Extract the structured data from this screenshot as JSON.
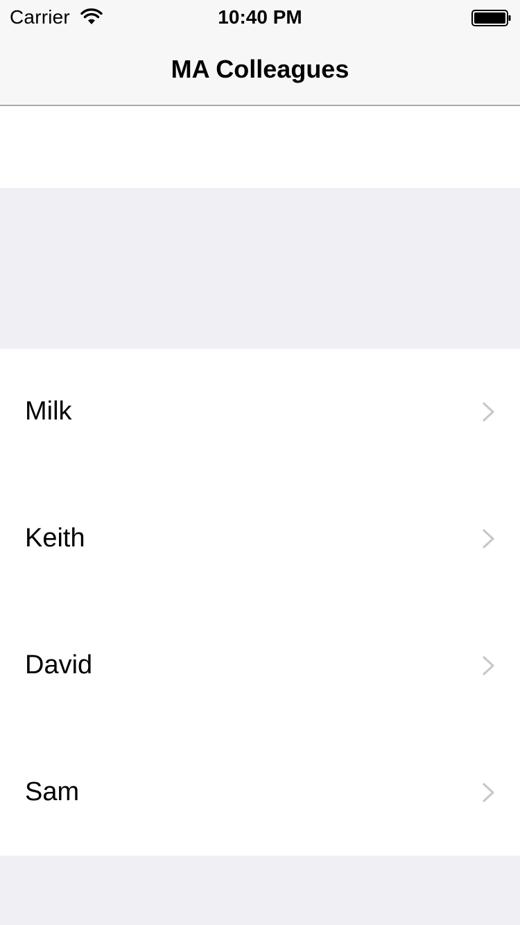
{
  "status_bar": {
    "carrier": "Carrier",
    "time": "10:40 PM",
    "wifi_icon": "wifi-icon",
    "battery_icon": "battery-icon"
  },
  "nav": {
    "title": "MA Colleagues"
  },
  "colleagues": {
    "items": [
      {
        "label": "Milk",
        "accessory_icon": "chevron-right-icon"
      },
      {
        "label": "Keith",
        "accessory_icon": "chevron-right-icon"
      },
      {
        "label": "David",
        "accessory_icon": "chevron-right-icon"
      },
      {
        "label": "Sam",
        "accessory_icon": "chevron-right-icon"
      }
    ]
  },
  "colors": {
    "background_grouped": "#efeff4",
    "nav_bar": "#f7f7f7",
    "chevron": "#c7c7cc",
    "separator": "#a7a7aa"
  }
}
